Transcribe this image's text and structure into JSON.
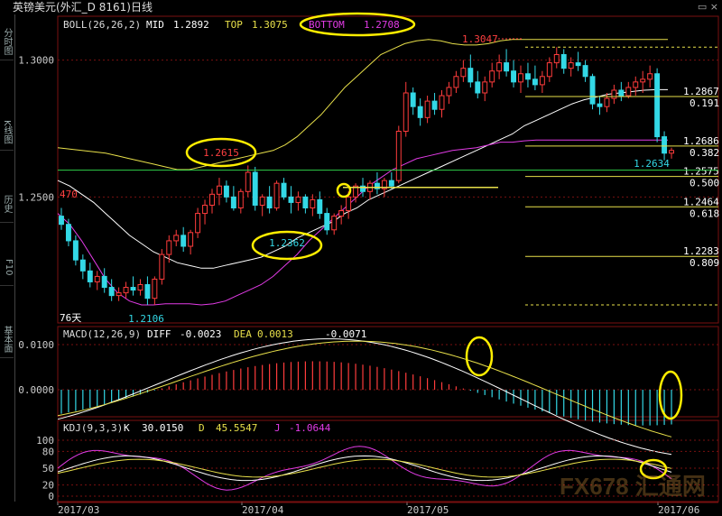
{
  "window": {
    "title": "英镑美元(外汇_D 8161)日线",
    "controls": "▭ ×"
  },
  "side_tabs": [
    "分时图",
    "K线图",
    "历史",
    "F10",
    "基本面"
  ],
  "colors": {
    "background": "#000000",
    "up_candle": "#ff3c3c",
    "down_candle": "#33d8e6",
    "boll_mid": "#ffffff",
    "boll_top": "#e8e04a",
    "boll_bottom": "#e23be6",
    "fib_line": "#e8e04a",
    "support_line": "#2fd04a",
    "annotation": "#ffee00",
    "grid": "#7a1010",
    "macd_diff": "#ffffff",
    "macd_dea": "#e8e04a",
    "kdj_k": "#ffffff",
    "kdj_d": "#e8e04a",
    "kdj_j": "#e23be6"
  },
  "boll": {
    "label": "BOLL(26,26,2)",
    "mid_label": "MID",
    "mid": "1.2892",
    "top_label": "TOP",
    "top": "1.3075",
    "bottom_label": "BOTTOM",
    "bottom": "1.2708"
  },
  "macd": {
    "label": "MACD(12,26,9)",
    "diff_label": "DIFF",
    "diff": "-0.0023",
    "dea_label": "DEA",
    "dea": "0.0013",
    "macd": "-0.0071"
  },
  "kdj": {
    "label": "KDJ(9,3,3)",
    "k_label": "K",
    "k": "30.0150",
    "d_label": "D",
    "d": "45.5547",
    "j_label": "J",
    "j": "-1.0644"
  },
  "price_axis": {
    "ticks": [
      "1.3000",
      "1.2500"
    ]
  },
  "macd_axis": {
    "ticks": [
      "0.0100",
      "0.0000"
    ]
  },
  "kdj_axis": {
    "ticks": [
      "100",
      "80",
      "50",
      "20",
      "0"
    ]
  },
  "x_axis": {
    "ticks": [
      "2017/03",
      "2017/04",
      "2017/05",
      "2017/06"
    ]
  },
  "annotations": {
    "high_label": "1.3047",
    "peak_label": "1.2615",
    "trough_label": "1.2362",
    "low_label": "1.2106",
    "recent_low_label": "1.2634",
    "days_label": "76天",
    "left_mark": "470"
  },
  "fib_levels": [
    {
      "price": "1.2867",
      "ratio": "0.191"
    },
    {
      "price": "1.2686",
      "ratio": "0.382"
    },
    {
      "price": "1.2575",
      "ratio": "0.500"
    },
    {
      "price": "1.2464",
      "ratio": "0.618"
    },
    {
      "price": "1.2283",
      "ratio": "0.809"
    }
  ],
  "watermark": "FX678 汇通网",
  "chart_data": {
    "type": "candlestick",
    "title": "英镑美元(外汇_D 8161)日线",
    "ylim": [
      1.204,
      1.316
    ],
    "candles_ohlc": [
      [
        1.243,
        1.246,
        1.238,
        1.24
      ],
      [
        1.24,
        1.242,
        1.232,
        1.234
      ],
      [
        1.234,
        1.236,
        1.225,
        1.227
      ],
      [
        1.227,
        1.229,
        1.22,
        1.223
      ],
      [
        1.223,
        1.226,
        1.217,
        1.219
      ],
      [
        1.219,
        1.223,
        1.216,
        1.221
      ],
      [
        1.221,
        1.224,
        1.215,
        1.217
      ],
      [
        1.217,
        1.22,
        1.212,
        1.214
      ],
      [
        1.214,
        1.217,
        1.212,
        1.215
      ],
      [
        1.215,
        1.219,
        1.213,
        1.217
      ],
      [
        1.217,
        1.221,
        1.214,
        1.216
      ],
      [
        1.216,
        1.22,
        1.214,
        1.218
      ],
      [
        1.218,
        1.221,
        1.2106,
        1.213
      ],
      [
        1.213,
        1.221,
        1.2106,
        1.22
      ],
      [
        1.22,
        1.231,
        1.218,
        1.229
      ],
      [
        1.229,
        1.236,
        1.226,
        1.234
      ],
      [
        1.234,
        1.238,
        1.232,
        1.236
      ],
      [
        1.236,
        1.239,
        1.23,
        1.232
      ],
      [
        1.232,
        1.238,
        1.229,
        1.237
      ],
      [
        1.237,
        1.246,
        1.235,
        1.244
      ],
      [
        1.244,
        1.249,
        1.24,
        1.247
      ],
      [
        1.247,
        1.253,
        1.244,
        1.251
      ],
      [
        1.251,
        1.257,
        1.247,
        1.254
      ],
      [
        1.254,
        1.256,
        1.248,
        1.25
      ],
      [
        1.25,
        1.254,
        1.245,
        1.246
      ],
      [
        1.246,
        1.253,
        1.244,
        1.252
      ],
      [
        1.252,
        1.2615,
        1.25,
        1.259
      ],
      [
        1.259,
        1.261,
        1.245,
        1.247
      ],
      [
        1.247,
        1.251,
        1.243,
        1.25
      ],
      [
        1.25,
        1.254,
        1.244,
        1.246
      ],
      [
        1.246,
        1.256,
        1.245,
        1.255
      ],
      [
        1.255,
        1.257,
        1.249,
        1.25
      ],
      [
        1.25,
        1.254,
        1.244,
        1.248
      ],
      [
        1.248,
        1.252,
        1.245,
        1.25
      ],
      [
        1.25,
        1.251,
        1.244,
        1.246
      ],
      [
        1.246,
        1.251,
        1.243,
        1.249
      ],
      [
        1.249,
        1.252,
        1.242,
        1.244
      ],
      [
        1.244,
        1.246,
        1.2362,
        1.238
      ],
      [
        1.238,
        1.244,
        1.2362,
        1.243
      ],
      [
        1.243,
        1.247,
        1.24,
        1.245
      ],
      [
        1.245,
        1.252,
        1.242,
        1.25
      ],
      [
        1.25,
        1.255,
        1.248,
        1.254
      ],
      [
        1.254,
        1.257,
        1.25,
        1.252
      ],
      [
        1.252,
        1.256,
        1.249,
        1.255
      ],
      [
        1.255,
        1.259,
        1.251,
        1.253
      ],
      [
        1.253,
        1.257,
        1.25,
        1.256
      ],
      [
        1.256,
        1.259,
        1.253,
        1.254
      ],
      [
        1.256,
        1.276,
        1.255,
        1.274
      ],
      [
        1.274,
        1.292,
        1.272,
        1.288
      ],
      [
        1.288,
        1.29,
        1.28,
        1.283
      ],
      [
        1.283,
        1.286,
        1.276,
        1.279
      ],
      [
        1.279,
        1.287,
        1.277,
        1.285
      ],
      [
        1.285,
        1.288,
        1.28,
        1.282
      ],
      [
        1.282,
        1.289,
        1.279,
        1.287
      ],
      [
        1.287,
        1.292,
        1.284,
        1.29
      ],
      [
        1.29,
        1.296,
        1.288,
        1.294
      ],
      [
        1.294,
        1.3,
        1.292,
        1.297
      ],
      [
        1.297,
        1.302,
        1.29,
        1.292
      ],
      [
        1.292,
        1.296,
        1.286,
        1.288
      ],
      [
        1.288,
        1.294,
        1.285,
        1.292
      ],
      [
        1.292,
        1.299,
        1.29,
        1.296
      ],
      [
        1.296,
        1.302,
        1.293,
        1.299
      ],
      [
        1.299,
        1.304,
        1.294,
        1.296
      ],
      [
        1.296,
        1.3,
        1.29,
        1.292
      ],
      [
        1.292,
        1.298,
        1.288,
        1.295
      ],
      [
        1.295,
        1.299,
        1.29,
        1.293
      ],
      [
        1.293,
        1.298,
        1.289,
        1.291
      ],
      [
        1.291,
        1.296,
        1.288,
        1.294
      ],
      [
        1.294,
        1.301,
        1.292,
        1.299
      ],
      [
        1.299,
        1.3047,
        1.297,
        1.302
      ],
      [
        1.302,
        1.304,
        1.295,
        1.297
      ],
      [
        1.297,
        1.301,
        1.294,
        1.299
      ],
      [
        1.299,
        1.303,
        1.296,
        1.298
      ],
      [
        1.298,
        1.3,
        1.292,
        1.294
      ],
      [
        1.294,
        1.295,
        1.282,
        1.284
      ],
      [
        1.284,
        1.287,
        1.28,
        1.283
      ],
      [
        1.283,
        1.288,
        1.281,
        1.286
      ],
      [
        1.286,
        1.291,
        1.284,
        1.289
      ],
      [
        1.289,
        1.292,
        1.285,
        1.287
      ],
      [
        1.287,
        1.292,
        1.286,
        1.29
      ],
      [
        1.29,
        1.294,
        1.287,
        1.292
      ],
      [
        1.292,
        1.296,
        1.288,
        1.293
      ],
      [
        1.293,
        1.298,
        1.29,
        1.295
      ],
      [
        1.295,
        1.297,
        1.27,
        1.272
      ],
      [
        1.272,
        1.274,
        1.2634,
        1.266
      ],
      [
        1.266,
        1.268,
        1.264,
        1.267
      ]
    ],
    "series": [
      {
        "name": "MID",
        "values": [
          1.256,
          1.254,
          1.251,
          1.248,
          1.244,
          1.24,
          1.236,
          1.233,
          1.23,
          1.228,
          1.226,
          1.225,
          1.224,
          1.224,
          1.225,
          1.226,
          1.227,
          1.228,
          1.23,
          1.232,
          1.235,
          1.237,
          1.239,
          1.241,
          1.244,
          1.246,
          1.249,
          1.251,
          1.253,
          1.255,
          1.257,
          1.259,
          1.261,
          1.263,
          1.265,
          1.267,
          1.269,
          1.271,
          1.273,
          1.276,
          1.278,
          1.28,
          1.282,
          1.284,
          1.2855,
          1.2865,
          1.2875,
          1.288,
          1.2885,
          1.289,
          1.2892,
          1.2892
        ]
      },
      {
        "name": "TOP",
        "values": [
          1.268,
          1.2675,
          1.267,
          1.2665,
          1.266,
          1.265,
          1.264,
          1.263,
          1.262,
          1.261,
          1.26,
          1.26,
          1.261,
          1.262,
          1.263,
          1.264,
          1.265,
          1.266,
          1.267,
          1.269,
          1.272,
          1.276,
          1.28,
          1.285,
          1.29,
          1.294,
          1.298,
          1.302,
          1.304,
          1.306,
          1.307,
          1.3075,
          1.307,
          1.306,
          1.3055,
          1.3055,
          1.306,
          1.307,
          1.3075,
          1.3075,
          1.3075,
          1.3075,
          1.3075,
          1.3075,
          1.3075,
          1.3075,
          1.3075,
          1.3075,
          1.3075,
          1.3075,
          1.3075,
          1.3075
        ]
      },
      {
        "name": "BOTTOM",
        "values": [
          1.244,
          1.24,
          1.234,
          1.227,
          1.22,
          1.215,
          1.212,
          1.2106,
          1.2106,
          1.211,
          1.211,
          1.211,
          1.2106,
          1.211,
          1.212,
          1.214,
          1.216,
          1.218,
          1.221,
          1.225,
          1.229,
          1.234,
          1.238,
          1.242,
          1.246,
          1.25,
          1.254,
          1.257,
          1.26,
          1.262,
          1.264,
          1.265,
          1.266,
          1.267,
          1.2675,
          1.268,
          1.269,
          1.27,
          1.27,
          1.2705,
          1.2708,
          1.2708,
          1.2708,
          1.2708,
          1.2708,
          1.2708,
          1.2708,
          1.2708,
          1.2708,
          1.2708,
          1.2708,
          1.2708
        ]
      }
    ]
  }
}
